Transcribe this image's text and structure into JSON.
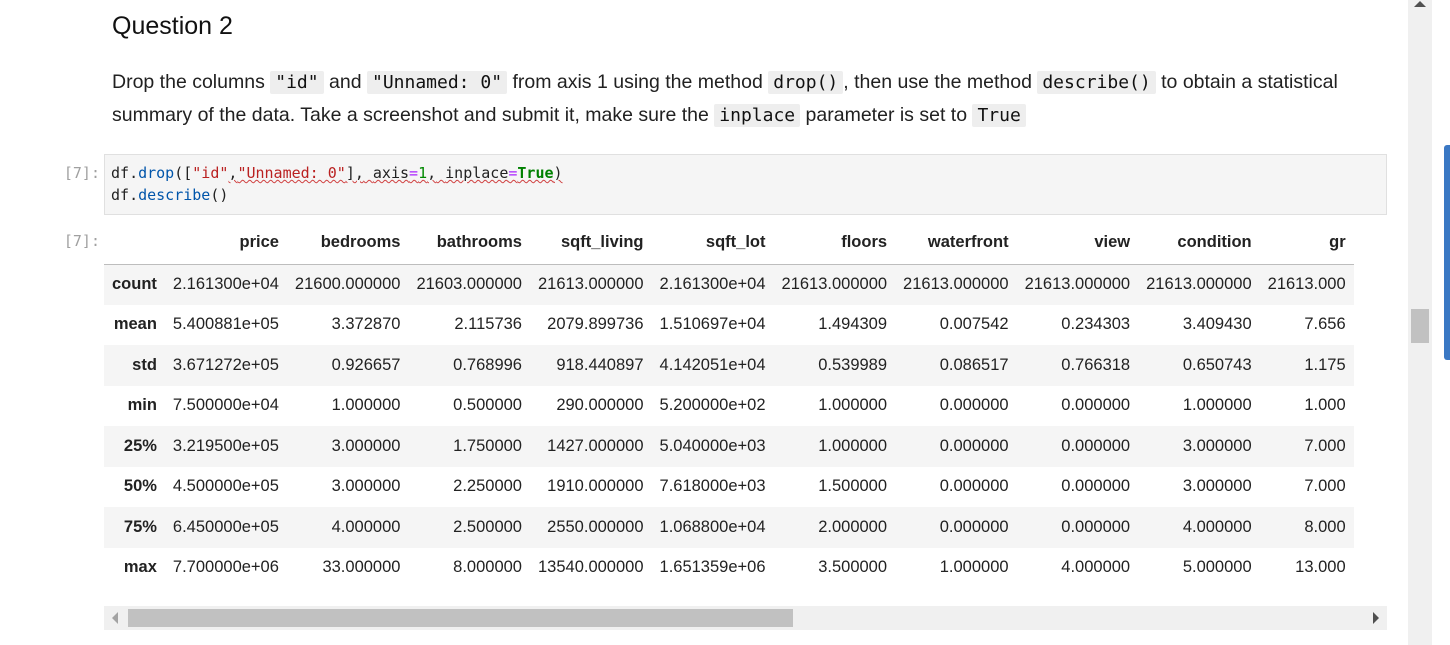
{
  "markdown": {
    "title": "Question 2",
    "p1": "Drop the columns ",
    "code1": "\"id\"",
    "p2": " and ",
    "code2": "\"Unnamed: 0\"",
    "p3": " from axis 1 using the method ",
    "code3": "drop()",
    "p4": ", then use the method ",
    "code4": "describe()",
    "p5": " to obtain a statistical summary of the data. Take a screenshot and submit it, make sure the ",
    "code5": "inplace",
    "p6": " parameter is set to ",
    "code6": "True"
  },
  "cell": {
    "in_prompt": "[7]:",
    "out_prompt": "[7]:",
    "line1": {
      "df": "df",
      "dot1": ".",
      "drop": "drop",
      "open": "([",
      "s1": "\"id\"",
      "comma1": ",",
      "s2": "\"Unnamed: 0\"",
      "close1": "],",
      "sp1": " ",
      "axis": "axis",
      "eq1": "=",
      "one": "1",
      "comma2": ",",
      "sp2": " ",
      "inplace": "inplace",
      "eq2": "=",
      "true": "True",
      "close2": ")"
    },
    "line2": {
      "df": "df",
      "dot": ".",
      "describe": "describe",
      "parens": "()"
    }
  },
  "table": {
    "columns": [
      "",
      "price",
      "bedrooms",
      "bathrooms",
      "sqft_living",
      "sqft_lot",
      "floors",
      "waterfront",
      "view",
      "condition",
      "gr"
    ],
    "rows": [
      {
        "label": "count",
        "values": [
          "2.161300e+04",
          "21600.000000",
          "21603.000000",
          "21613.000000",
          "2.161300e+04",
          "21613.000000",
          "21613.000000",
          "21613.000000",
          "21613.000000",
          "21613.000"
        ]
      },
      {
        "label": "mean",
        "values": [
          "5.400881e+05",
          "3.372870",
          "2.115736",
          "2079.899736",
          "1.510697e+04",
          "1.494309",
          "0.007542",
          "0.234303",
          "3.409430",
          "7.656"
        ]
      },
      {
        "label": "std",
        "values": [
          "3.671272e+05",
          "0.926657",
          "0.768996",
          "918.440897",
          "4.142051e+04",
          "0.539989",
          "0.086517",
          "0.766318",
          "0.650743",
          "1.175"
        ]
      },
      {
        "label": "min",
        "values": [
          "7.500000e+04",
          "1.000000",
          "0.500000",
          "290.000000",
          "5.200000e+02",
          "1.000000",
          "0.000000",
          "0.000000",
          "1.000000",
          "1.000"
        ]
      },
      {
        "label": "25%",
        "values": [
          "3.219500e+05",
          "3.000000",
          "1.750000",
          "1427.000000",
          "5.040000e+03",
          "1.000000",
          "0.000000",
          "0.000000",
          "3.000000",
          "7.000"
        ]
      },
      {
        "label": "50%",
        "values": [
          "4.500000e+05",
          "3.000000",
          "2.250000",
          "1910.000000",
          "7.618000e+03",
          "1.500000",
          "0.000000",
          "0.000000",
          "3.000000",
          "7.000"
        ]
      },
      {
        "label": "75%",
        "values": [
          "6.450000e+05",
          "4.000000",
          "2.500000",
          "2550.000000",
          "1.068800e+04",
          "2.000000",
          "0.000000",
          "0.000000",
          "4.000000",
          "8.000"
        ]
      },
      {
        "label": "max",
        "values": [
          "7.700000e+06",
          "33.000000",
          "8.000000",
          "13540.000000",
          "1.651359e+06",
          "3.500000",
          "1.000000",
          "4.000000",
          "5.000000",
          "13.000"
        ]
      }
    ]
  },
  "icons": {
    "h_left": "scroll-left-arrow-icon",
    "h_right": "scroll-right-arrow-icon",
    "v_up": "scroll-up-arrow-icon"
  },
  "colors": {
    "code_bg": "#f5f5f5",
    "string": "#ba2121",
    "keyword": "#008000",
    "function": "#0055aa",
    "prompt": "#a0a0a0"
  }
}
